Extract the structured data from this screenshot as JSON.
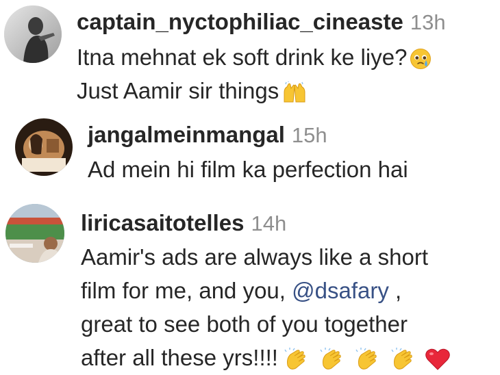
{
  "comments": [
    {
      "username": "captain_nyctophiliac_cineaste",
      "time": "13h",
      "lines": [
        "Itna mehnat ek soft drink ke liye?",
        "Just Aamir sir things"
      ],
      "emojis": [
        "pleading-tear-face",
        "raising-hands"
      ]
    },
    {
      "username": "jangalmeinmangal",
      "time": "15h",
      "lines": [
        "Ad mein hi film ka perfection hai"
      ]
    },
    {
      "username": "liricasaitotelles",
      "time": "14h",
      "lines": [
        "Aamir's ads are always like a short",
        "film for me, and you,",
        "great to see both of you together",
        "after all these yrs!!!!"
      ],
      "mention": "@dsafary",
      "mention_suffix": " ,",
      "emojis": [
        "clapping-hands",
        "clapping-hands",
        "clapping-hands",
        "clapping-hands",
        "red-heart"
      ]
    }
  ],
  "colors": {
    "text": "#262626",
    "muted": "#8e8e8e",
    "mention": "#385185",
    "background": "#ffffff"
  }
}
